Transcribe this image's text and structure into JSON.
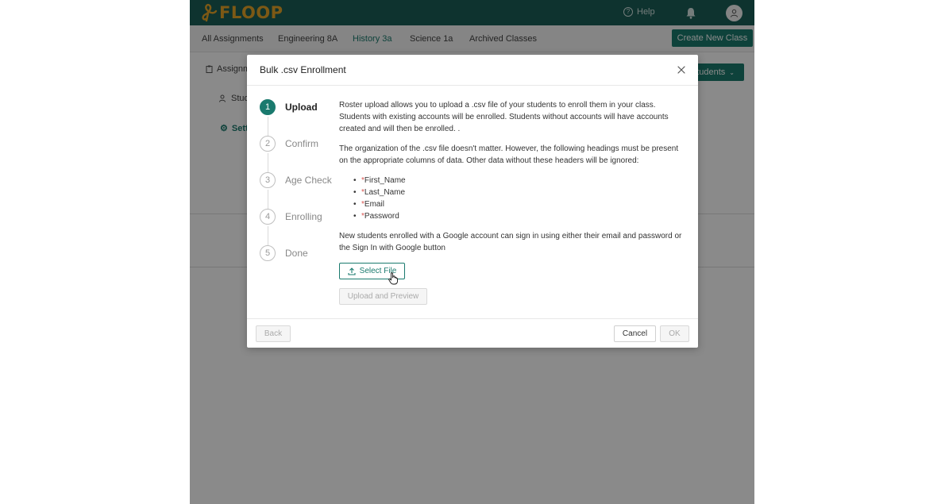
{
  "app": {
    "logo_text": "FLOOP",
    "help_label": "Help"
  },
  "tabs": [
    {
      "label": "All Assignments",
      "active": false
    },
    {
      "label": "Engineering 8A",
      "active": false
    },
    {
      "label": "History 3a",
      "active": true
    },
    {
      "label": "Science 1a",
      "active": false
    },
    {
      "label": "Archived Classes",
      "active": false
    }
  ],
  "create_class_label": "Create New Class",
  "background": {
    "side_items": [
      "Assignm",
      "Stud",
      "Sett"
    ],
    "add_students_label": "tudents"
  },
  "modal": {
    "title": "Bulk .csv Enrollment",
    "steps": [
      {
        "num": "1",
        "label": "Upload",
        "active": true
      },
      {
        "num": "2",
        "label": "Confirm",
        "active": false
      },
      {
        "num": "3",
        "label": "Age Check",
        "active": false
      },
      {
        "num": "4",
        "label": "Enrolling",
        "active": false
      },
      {
        "num": "5",
        "label": "Done",
        "active": false
      }
    ],
    "para1": "Roster upload allows you to upload a .csv file of your students to enroll them in your class. Students with existing accounts will be enrolled. Students without accounts will have accounts created and will then be enrolled. .",
    "para2": "The organization of the .csv file doesn't matter. However, the following headings must be present on the appropriate columns of data. Other data without these headers will be ignored:",
    "required_prefix": "*",
    "required_headers": [
      "First_Name",
      "Last_Name",
      "Email",
      "Password"
    ],
    "para3": "New students enrolled with a Google account can sign in using either their email and password or the Sign In with Google button",
    "select_file_label": "Select File",
    "upload_preview_label": "Upload and Preview",
    "back_label": "Back",
    "cancel_label": "Cancel",
    "ok_label": "OK"
  },
  "colors": {
    "brand": "#1a7a6e",
    "topbar": "#1a5f58",
    "logo": "#e8a528"
  }
}
